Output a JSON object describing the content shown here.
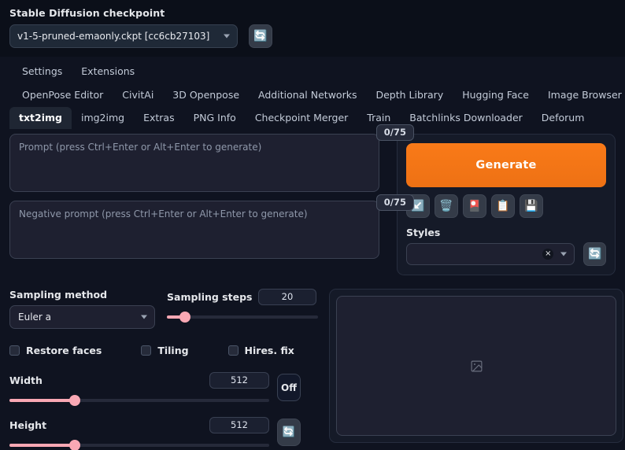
{
  "header": {
    "checkpoint_label": "Stable Diffusion checkpoint",
    "checkpoint_value": "v1-5-pruned-emaonly.ckpt [cc6cb27103]",
    "refresh_icon": "refresh-icon",
    "refresh_glyph": "🔄"
  },
  "nav": {
    "top_row": [
      {
        "label": "Settings",
        "name": "nav-settings"
      },
      {
        "label": "Extensions",
        "name": "nav-extensions"
      }
    ],
    "second_row": [
      {
        "label": "OpenPose Editor",
        "name": "nav-openpose-editor"
      },
      {
        "label": "CivitAi",
        "name": "nav-civitai"
      },
      {
        "label": "3D Openpose",
        "name": "nav-3d-openpose"
      },
      {
        "label": "Additional Networks",
        "name": "nav-additional-networks"
      },
      {
        "label": "Depth Library",
        "name": "nav-depth-library"
      },
      {
        "label": "Hugging Face",
        "name": "nav-hugging-face"
      },
      {
        "label": "Image Browser",
        "name": "nav-image-browser"
      }
    ],
    "tabs": [
      {
        "label": "txt2img",
        "name": "tab-txt2img",
        "active": true
      },
      {
        "label": "img2img",
        "name": "tab-img2img",
        "active": false
      },
      {
        "label": "Extras",
        "name": "tab-extras",
        "active": false
      },
      {
        "label": "PNG Info",
        "name": "tab-png-info",
        "active": false
      },
      {
        "label": "Checkpoint Merger",
        "name": "tab-checkpoint-merger",
        "active": false
      },
      {
        "label": "Train",
        "name": "tab-train",
        "active": false
      },
      {
        "label": "Batchlinks Downloader",
        "name": "tab-batchlinks-downloader",
        "active": false
      },
      {
        "label": "Deforum",
        "name": "tab-deforum",
        "active": false
      }
    ]
  },
  "prompt": {
    "positive_placeholder": "Prompt (press Ctrl+Enter or Alt+Enter to generate)",
    "positive_value": "",
    "positive_tokens": "0/75",
    "negative_placeholder": "Negative prompt (press Ctrl+Enter or Alt+Enter to generate)",
    "negative_value": "",
    "negative_tokens": "0/75"
  },
  "generate": {
    "button_label": "Generate",
    "accent_color": "#ee7114",
    "tools": [
      {
        "name": "restore-progress-icon",
        "glyph": "↙️",
        "title": "arrow-down-left"
      },
      {
        "name": "clear-prompt-icon",
        "glyph": "🗑️",
        "title": "trash"
      },
      {
        "name": "show-extra-networks-icon",
        "glyph": "🎴",
        "title": "cards"
      },
      {
        "name": "apply-style-icon",
        "glyph": "📋",
        "title": "clipboard"
      },
      {
        "name": "save-style-icon",
        "glyph": "💾",
        "title": "floppy-disk"
      }
    ],
    "styles_label": "Styles",
    "styles_value": "",
    "styles_clear_glyph": "×",
    "styles_refresh_glyph": "🔄"
  },
  "settings": {
    "sampling_method_label": "Sampling method",
    "sampling_method_value": "Euler a",
    "sampling_steps_label": "Sampling steps",
    "sampling_steps_value": "20",
    "sampling_steps_pct": 12,
    "checkboxes": [
      {
        "label": "Restore faces",
        "name": "checkbox-restore-faces",
        "checked": false
      },
      {
        "label": "Tiling",
        "name": "checkbox-tiling",
        "checked": false
      },
      {
        "label": "Hires. fix",
        "name": "checkbox-hires-fix",
        "checked": false
      }
    ],
    "width_label": "Width",
    "width_value": "512",
    "width_pct": 25,
    "height_label": "Height",
    "height_value": "512",
    "height_pct": 25,
    "batch_toggle_label": "Off",
    "swap_glyph": "🔄"
  },
  "gallery": {
    "placeholder_icon": "image-placeholder-icon"
  }
}
